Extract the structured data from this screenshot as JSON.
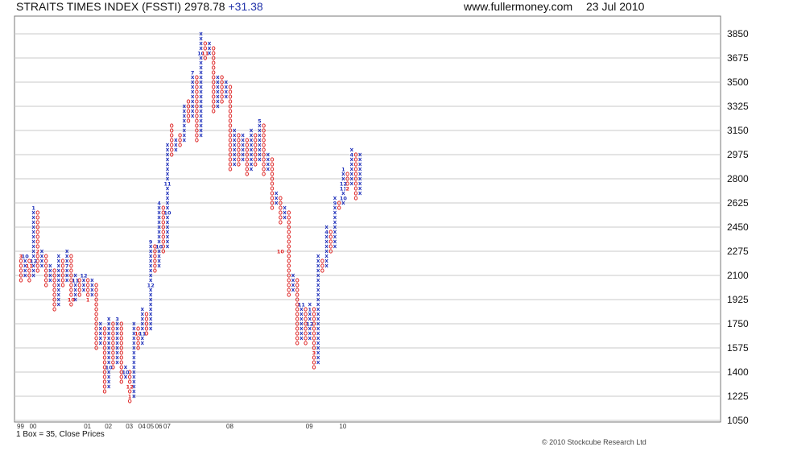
{
  "header": {
    "title": "STRAITS TIMES INDEX (FSSTI)",
    "price": "2978.78",
    "change": "+31.38",
    "site": "www.fullermoney.com",
    "date": "23 Jul 2010"
  },
  "footer": {
    "box_note": "1 Box = 35, Close Prices",
    "copyright": "© 2010 Stockcube Research Ltd"
  },
  "chart_data": {
    "type": "point-and-figure",
    "box_size": 35,
    "price_basis": "Close Prices",
    "ylim": [
      1050,
      3850
    ],
    "y_ticks": [
      1050,
      1225,
      1400,
      1575,
      1750,
      1925,
      2100,
      2275,
      2450,
      2625,
      2800,
      2975,
      3150,
      3325,
      3500,
      3675,
      3850
    ],
    "x_year_labels": [
      {
        "label": "99",
        "col": 0
      },
      {
        "label": "00",
        "col": 3
      },
      {
        "label": "01",
        "col": 16
      },
      {
        "label": "02",
        "col": 21
      },
      {
        "label": "03",
        "col": 26
      },
      {
        "label": "04",
        "col": 29
      },
      {
        "label": "05",
        "col": 31
      },
      {
        "label": "06",
        "col": 33
      },
      {
        "label": "07",
        "col": 35
      },
      {
        "label": "08",
        "col": 50
      },
      {
        "label": "09",
        "col": 69
      },
      {
        "label": "10",
        "col": 77
      }
    ],
    "colors": {
      "x": "#2233bb",
      "o": "#dd2222",
      "grid": "#c8c8c8"
    },
    "columns": [
      {
        "t": "o",
        "lo": 2065,
        "hi": 2240
      },
      {
        "t": "x",
        "lo": 2100,
        "hi": 2240
      },
      {
        "t": "o",
        "lo": 2065,
        "hi": 2205
      },
      {
        "t": "x",
        "lo": 2100,
        "hi": 2590
      },
      {
        "t": "o",
        "lo": 2135,
        "hi": 2555
      },
      {
        "t": "x",
        "lo": 2170,
        "hi": 2275
      },
      {
        "t": "o",
        "lo": 2030,
        "hi": 2240
      },
      {
        "t": "x",
        "lo": 2065,
        "hi": 2170
      },
      {
        "t": "o",
        "lo": 1855,
        "hi": 2135
      },
      {
        "t": "x",
        "lo": 1890,
        "hi": 2240
      },
      {
        "t": "o",
        "lo": 2030,
        "hi": 2205
      },
      {
        "t": "x",
        "lo": 2065,
        "hi": 2275
      },
      {
        "t": "o",
        "lo": 1890,
        "hi": 2240
      },
      {
        "t": "x",
        "lo": 1925,
        "hi": 2100
      },
      {
        "t": "o",
        "lo": 1960,
        "hi": 2065
      },
      {
        "t": "x",
        "lo": 1995,
        "hi": 2100
      },
      {
        "t": "o",
        "lo": 1925,
        "hi": 2065
      },
      {
        "t": "x",
        "lo": 1960,
        "hi": 2065
      },
      {
        "t": "o",
        "lo": 1575,
        "hi": 2030
      },
      {
        "t": "x",
        "lo": 1610,
        "hi": 1750
      },
      {
        "t": "o",
        "lo": 1260,
        "hi": 1715
      },
      {
        "t": "x",
        "lo": 1295,
        "hi": 1785
      },
      {
        "t": "o",
        "lo": 1435,
        "hi": 1750
      },
      {
        "t": "x",
        "lo": 1470,
        "hi": 1785
      },
      {
        "t": "o",
        "lo": 1330,
        "hi": 1750
      },
      {
        "t": "x",
        "lo": 1365,
        "hi": 1435
      },
      {
        "t": "o",
        "lo": 1190,
        "hi": 1400
      },
      {
        "t": "x",
        "lo": 1225,
        "hi": 1750
      },
      {
        "t": "o",
        "lo": 1575,
        "hi": 1715
      },
      {
        "t": "x",
        "lo": 1610,
        "hi": 1855
      },
      {
        "t": "o",
        "lo": 1680,
        "hi": 1820
      },
      {
        "t": "x",
        "lo": 1715,
        "hi": 2345
      },
      {
        "t": "o",
        "lo": 2135,
        "hi": 2310
      },
      {
        "t": "x",
        "lo": 2170,
        "hi": 2625
      },
      {
        "t": "o",
        "lo": 2275,
        "hi": 2590
      },
      {
        "t": "x",
        "lo": 2310,
        "hi": 3045
      },
      {
        "t": "o",
        "lo": 2975,
        "hi": 3185
      },
      {
        "t": "x",
        "lo": 3010,
        "hi": 3080
      },
      {
        "t": "o",
        "lo": 3045,
        "hi": 3115
      },
      {
        "t": "x",
        "lo": 3080,
        "hi": 3325
      },
      {
        "t": "o",
        "lo": 3220,
        "hi": 3360
      },
      {
        "t": "x",
        "lo": 3255,
        "hi": 3570
      },
      {
        "t": "o",
        "lo": 3080,
        "hi": 3535
      },
      {
        "t": "x",
        "lo": 3115,
        "hi": 3850
      },
      {
        "t": "o",
        "lo": 3675,
        "hi": 3780
      },
      {
        "t": "x",
        "lo": 3710,
        "hi": 3780
      },
      {
        "t": "o",
        "lo": 3290,
        "hi": 3745
      },
      {
        "t": "x",
        "lo": 3325,
        "hi": 3535
      },
      {
        "t": "o",
        "lo": 3360,
        "hi": 3535
      },
      {
        "t": "x",
        "lo": 3395,
        "hi": 3500
      },
      {
        "t": "o",
        "lo": 2870,
        "hi": 3465
      },
      {
        "t": "x",
        "lo": 2905,
        "hi": 3150
      },
      {
        "t": "o",
        "lo": 2905,
        "hi": 3115
      },
      {
        "t": "x",
        "lo": 2940,
        "hi": 3115
      },
      {
        "t": "o",
        "lo": 2835,
        "hi": 3080
      },
      {
        "t": "x",
        "lo": 2870,
        "hi": 3150
      },
      {
        "t": "o",
        "lo": 2905,
        "hi": 3115
      },
      {
        "t": "x",
        "lo": 2940,
        "hi": 3220
      },
      {
        "t": "o",
        "lo": 2835,
        "hi": 3185
      },
      {
        "t": "x",
        "lo": 2870,
        "hi": 2975
      },
      {
        "t": "o",
        "lo": 2590,
        "hi": 2940
      },
      {
        "t": "x",
        "lo": 2625,
        "hi": 2695
      },
      {
        "t": "o",
        "lo": 2485,
        "hi": 2660
      },
      {
        "t": "x",
        "lo": 2520,
        "hi": 2590
      },
      {
        "t": "o",
        "lo": 1960,
        "hi": 2555
      },
      {
        "t": "x",
        "lo": 1995,
        "hi": 2100
      },
      {
        "t": "o",
        "lo": 1610,
        "hi": 2065
      },
      {
        "t": "x",
        "lo": 1645,
        "hi": 1890
      },
      {
        "t": "o",
        "lo": 1610,
        "hi": 1855
      },
      {
        "t": "x",
        "lo": 1645,
        "hi": 1890
      },
      {
        "t": "o",
        "lo": 1435,
        "hi": 1855
      },
      {
        "t": "x",
        "lo": 1470,
        "hi": 2240
      },
      {
        "t": "o",
        "lo": 2135,
        "hi": 2205
      },
      {
        "t": "x",
        "lo": 2170,
        "hi": 2450
      },
      {
        "t": "o",
        "lo": 2275,
        "hi": 2415
      },
      {
        "t": "x",
        "lo": 2310,
        "hi": 2660
      },
      {
        "t": "o",
        "lo": 2590,
        "hi": 2625
      },
      {
        "t": "x",
        "lo": 2625,
        "hi": 2870
      },
      {
        "t": "o",
        "lo": 2730,
        "hi": 2835
      },
      {
        "t": "x",
        "lo": 2765,
        "hi": 3010
      },
      {
        "t": "o",
        "lo": 2660,
        "hi": 2975
      },
      {
        "t": "x",
        "lo": 2695,
        "hi": 2975
      }
    ],
    "month_markers": [
      {
        "col": 0,
        "p": 2240,
        "m": "3"
      },
      {
        "col": 1,
        "p": 2240,
        "m": "10"
      },
      {
        "col": 2,
        "p": 2170,
        "m": "11"
      },
      {
        "col": 3,
        "p": 2590,
        "m": "1"
      },
      {
        "col": 3,
        "p": 2205,
        "m": "12"
      },
      {
        "col": 4,
        "p": 2275,
        "m": "2"
      },
      {
        "col": 11,
        "p": 2170,
        "m": "7"
      },
      {
        "col": 13,
        "p": 2065,
        "m": "11"
      },
      {
        "col": 12,
        "p": 1925,
        "m": "10"
      },
      {
        "col": 15,
        "p": 2100,
        "m": "12"
      },
      {
        "col": 16,
        "p": 1925,
        "m": "1"
      },
      {
        "col": 20,
        "p": 1645,
        "m": "7"
      },
      {
        "col": 21,
        "p": 1435,
        "m": "10"
      },
      {
        "col": 23,
        "p": 1785,
        "m": "3"
      },
      {
        "col": 25,
        "p": 1400,
        "m": "10"
      },
      {
        "col": 26,
        "p": 1295,
        "m": "12"
      },
      {
        "col": 26,
        "p": 1225,
        "m": "1"
      },
      {
        "col": 28,
        "p": 1680,
        "m": "10"
      },
      {
        "col": 29,
        "p": 1680,
        "m": "11"
      },
      {
        "col": 31,
        "p": 2345,
        "m": "9"
      },
      {
        "col": 31,
        "p": 2030,
        "m": "12"
      },
      {
        "col": 33,
        "p": 2625,
        "m": "4"
      },
      {
        "col": 33,
        "p": 2310,
        "m": "10"
      },
      {
        "col": 35,
        "p": 2555,
        "m": "10"
      },
      {
        "col": 35,
        "p": 2765,
        "m": "11"
      },
      {
        "col": 41,
        "p": 3570,
        "m": "7"
      },
      {
        "col": 43,
        "p": 3710,
        "m": "10"
      },
      {
        "col": 44,
        "p": 3710,
        "m": "11"
      },
      {
        "col": 57,
        "p": 3220,
        "m": "5"
      },
      {
        "col": 62,
        "p": 2275,
        "m": "10"
      },
      {
        "col": 67,
        "p": 1890,
        "m": "11"
      },
      {
        "col": 69,
        "p": 1855,
        "m": "1"
      },
      {
        "col": 69,
        "p": 1750,
        "m": "12"
      },
      {
        "col": 70,
        "p": 1540,
        "m": "3"
      },
      {
        "col": 73,
        "p": 2415,
        "m": "4"
      },
      {
        "col": 75,
        "p": 2625,
        "m": "9"
      },
      {
        "col": 77,
        "p": 2870,
        "m": "1"
      },
      {
        "col": 77,
        "p": 2765,
        "m": "12"
      },
      {
        "col": 77,
        "p": 2730,
        "m": "11"
      },
      {
        "col": 77,
        "p": 2660,
        "m": "10"
      },
      {
        "col": 78,
        "p": 2730,
        "m": "2"
      },
      {
        "col": 79,
        "p": 2975,
        "m": "4"
      }
    ]
  }
}
